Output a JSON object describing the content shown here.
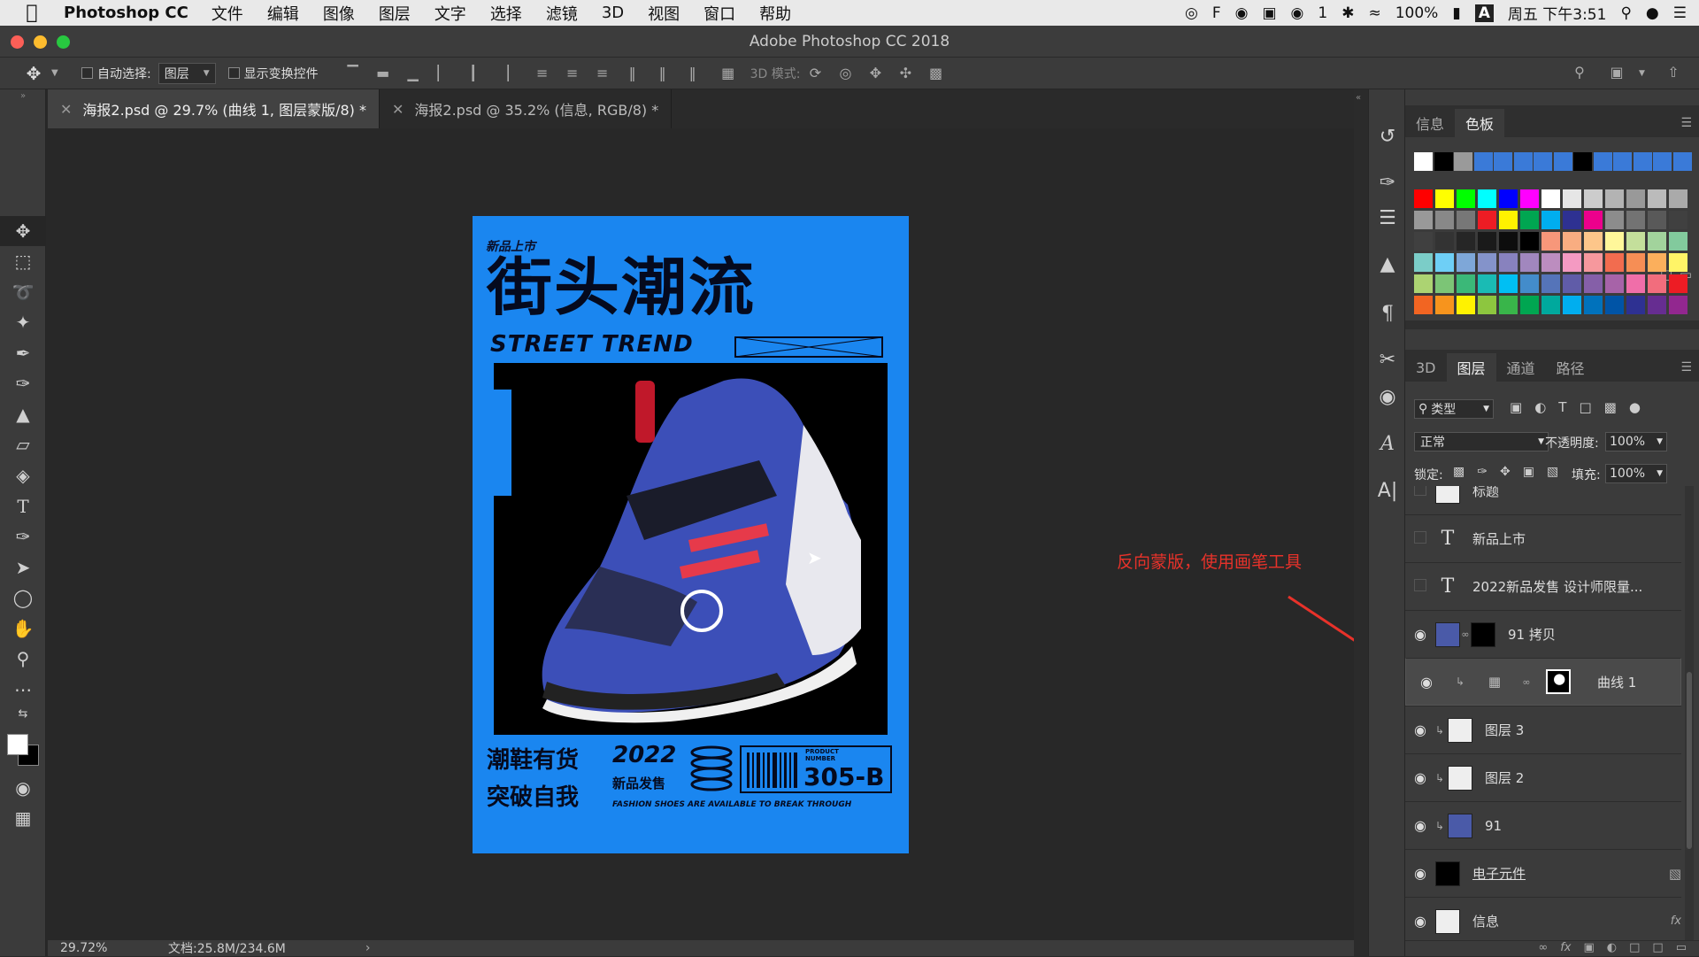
{
  "menubar": {
    "app_name": "Photoshop CC",
    "items": [
      "文件",
      "编辑",
      "图像",
      "图层",
      "文字",
      "选择",
      "滤镜",
      "3D",
      "视图",
      "窗口",
      "帮助"
    ],
    "wechat_count": "1",
    "battery": "100%",
    "input_method": "A",
    "clock": "周五 下午3:51"
  },
  "window": {
    "title": "Adobe Photoshop CC 2018"
  },
  "options_bar": {
    "auto_select_label": "自动选择:",
    "auto_select_value": "图层",
    "show_transform_label": "显示变换控件",
    "mode_3d_label": "3D 模式:"
  },
  "tabs": [
    {
      "label": "海报2.psd @ 29.7% (曲线 1, 图层蒙版/8) *"
    },
    {
      "label": "海报2.psd @ 35.2% (信息, RGB/8) *"
    }
  ],
  "poster": {
    "tag": "新品上市",
    "headline": "街头潮流",
    "subhead": "STREET TREND",
    "line1": "潮鞋有货",
    "year": "2022",
    "launch": "新品发售",
    "line2": "突破自我",
    "product_label_1": "PRODUCT",
    "product_label_2": "NUMBER",
    "product_number": "305-B",
    "slogan": "FASHION SHOES ARE AVAILABLE TO BREAK THROUGH"
  },
  "annotation": {
    "text": "反向蒙版，使用画笔工具",
    "color": "#e8322a"
  },
  "status": {
    "zoom": "29.72%",
    "doc": "文档:25.8M/234.6M"
  },
  "swatch_panel": {
    "tabs": [
      "信息",
      "色板"
    ],
    "top_row": [
      "#ffffff",
      "#000000",
      "#9a9a9a",
      "#3a7ad8",
      "#3a7ad8",
      "#3a7ad8",
      "#3a7ad8",
      "#3a7ad8",
      "#000000",
      "#3a7ad8",
      "#3a7ad8",
      "#3a7ad8",
      "#3a7ad8",
      "#3a7ad8"
    ],
    "grid": [
      [
        "#ff0000",
        "#ffff00",
        "#00ff00",
        "#00ffff",
        "#0000ff",
        "#ff00ff",
        "#ffffff",
        "#e6e6e6",
        "#cccccc",
        "#b3b3b3",
        "#999999",
        "#bbbbbb",
        "#aaaaaa"
      ],
      [
        "#999999",
        "#888888",
        "#777777",
        "#ed1c24",
        "#fff200",
        "#00a651",
        "#00aeef",
        "#2e3192",
        "#ec008c",
        "#8c8c8c",
        "#737373",
        "#595959",
        "#404040"
      ],
      [
        "#404040",
        "#333333",
        "#262626",
        "#1a1a1a",
        "#0d0d0d",
        "#000000",
        "#f7977a",
        "#f9ad81",
        "#fdc68a",
        "#fff79a",
        "#c4df9b",
        "#a2d39c",
        "#82ca9d"
      ],
      [
        "#7bcdc8",
        "#6ecff6",
        "#7ea7d8",
        "#8493ca",
        "#8882be",
        "#a187be",
        "#bc8dbf",
        "#f49ac2",
        "#f6989d",
        "#f26c4f",
        "#f68e55",
        "#fbaf5c",
        "#fff467"
      ],
      [
        "#acd372",
        "#7cc576",
        "#3bb878",
        "#1abbb4",
        "#00bff3",
        "#438ccb",
        "#5574b9",
        "#605ca8",
        "#855fa8",
        "#a763a8",
        "#f06ea9",
        "#f26d7d",
        "#ed1c24"
      ],
      [
        "#f26522",
        "#f7941d",
        "#fff200",
        "#8dc63f",
        "#39b54a",
        "#00a651",
        "#00a99d",
        "#00aeef",
        "#0072bc",
        "#0054a6",
        "#2e3192",
        "#662d91",
        "#92278f"
      ]
    ]
  },
  "layers_panel": {
    "tabs": [
      "3D",
      "图层",
      "通道",
      "路径"
    ],
    "filter_label": "类型",
    "blend_mode": "正常",
    "opacity_label": "不透明度:",
    "opacity": "100%",
    "lock_label": "锁定:",
    "fill_label": "填充:",
    "fill": "100%",
    "layers": [
      {
        "name": "标题",
        "type": "group"
      },
      {
        "name": "新品上市",
        "type": "text"
      },
      {
        "name": "2022新品发售 设计师限量...",
        "type": "text"
      },
      {
        "name": "91 拷贝",
        "type": "pixel"
      },
      {
        "name": "曲线 1",
        "type": "adjustment"
      },
      {
        "name": "图层 3",
        "type": "pixel"
      },
      {
        "name": "图层 2",
        "type": "pixel"
      },
      {
        "name": "91",
        "type": "pixel"
      },
      {
        "name": "电子元件",
        "type": "pixel"
      },
      {
        "name": "信息",
        "type": "pixel"
      }
    ]
  }
}
